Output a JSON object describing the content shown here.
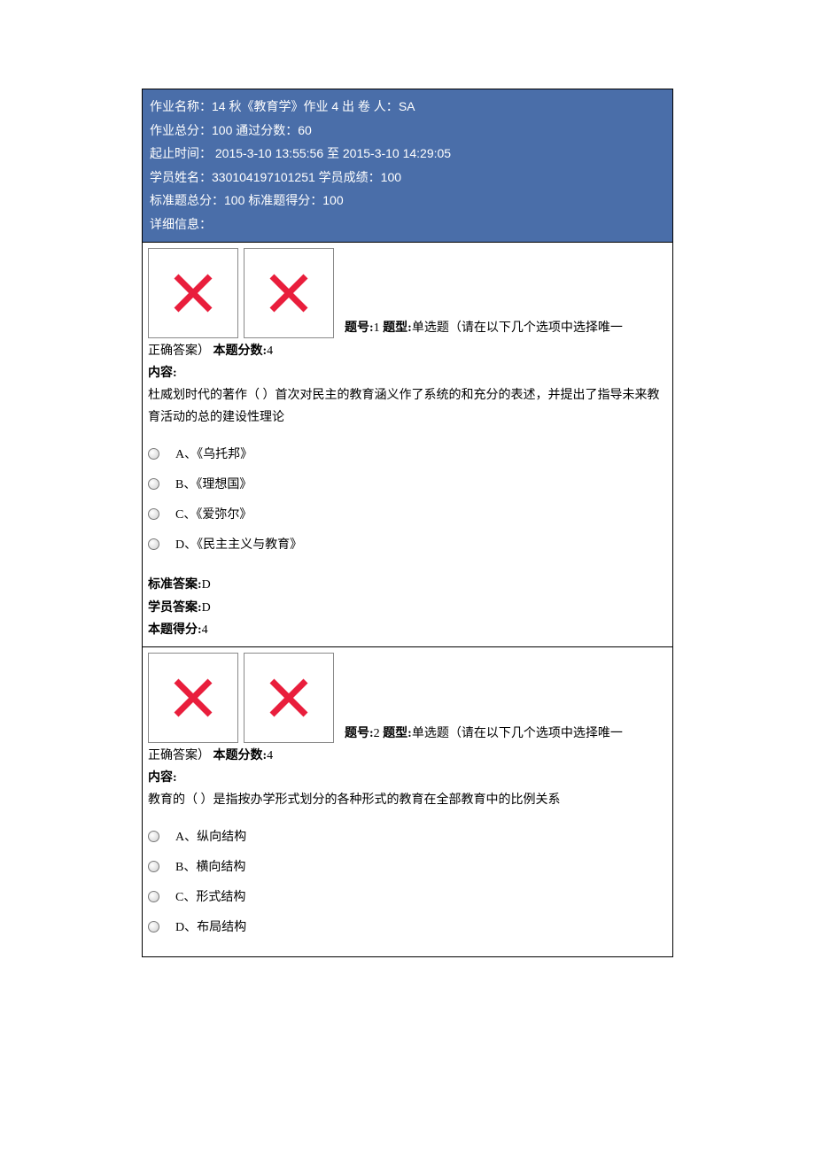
{
  "header": {
    "line1_label": "作业名称：",
    "line1_value": "14 秋《教育学》作业 4",
    "line1_author_label": "  出 卷 人：",
    "line1_author": "SA",
    "line2": "作业总分：100  通过分数：60",
    "line3": "起止时间：   2015-3-10 13:55:56 至 2015-3-10 14:29:05",
    "line4": "学员姓名：330104197101251  学员成绩：100",
    "line5": "标准题总分：100  标准题得分：100",
    "line6": "详细信息："
  },
  "questions": [
    {
      "meta_prefix": "题号:",
      "num": "1",
      "type_label": "  题型:",
      "type_text": "单选题（请在以下几个选项中选择唯一正确答案）",
      "score_label": "  本题分数:",
      "score": "4",
      "content_label": "内容:",
      "content_text": "杜威划时代的著作（  ）首次对民主的教育涵义作了系统的和充分的表述，并提出了指导未来教育活动的总的建设性理论",
      "options": [
        "A、《乌托邦》",
        "B、《理想国》",
        "C、《爱弥尔》",
        "D、《民主主义与教育》"
      ],
      "std_ans_label": "标准答案:",
      "std_ans": "D",
      "stu_ans_label": "学员答案:",
      "stu_ans": "D",
      "got_label": "本题得分:",
      "got": "4"
    },
    {
      "meta_prefix": "题号:",
      "num": "2",
      "type_label": "  题型:",
      "type_text": "单选题（请在以下几个选项中选择唯一正确答案）",
      "score_label": "  本题分数:",
      "score": "4",
      "content_label": "内容:",
      "content_text": "教育的（  ）是指按办学形式划分的各种形式的教育在全部教育中的比例关系",
      "options": [
        "A、纵向结构",
        "B、横向结构",
        "C、形式结构",
        "D、布局结构"
      ]
    }
  ]
}
